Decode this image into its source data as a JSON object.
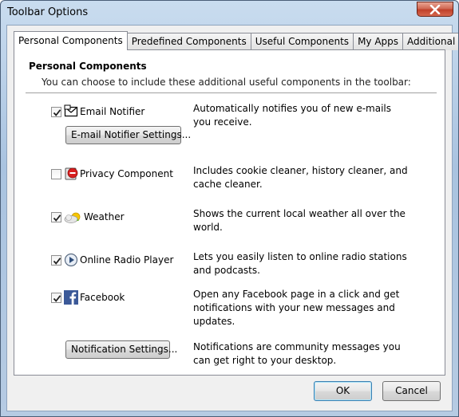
{
  "window": {
    "title": "Toolbar Options"
  },
  "tabs": [
    {
      "label": "Personal Components",
      "active": true
    },
    {
      "label": "Predefined Components"
    },
    {
      "label": "Useful Components"
    },
    {
      "label": "My Apps"
    },
    {
      "label": "Additional Settings"
    }
  ],
  "panel": {
    "title": "Personal Components",
    "description": "You can choose to include these additional useful components in the toolbar:"
  },
  "components": [
    {
      "label": "Email Notifier",
      "checked": true,
      "icon": "envelope-icon",
      "description": "Automatically notifies you of new e-mails you receive."
    },
    {
      "label": "Privacy Component",
      "checked": false,
      "icon": "privacy-icon",
      "description": "Includes cookie cleaner, history cleaner, and cache cleaner."
    },
    {
      "label": "Weather",
      "checked": true,
      "icon": "weather-icon",
      "description": "Shows the current local weather all over the world."
    },
    {
      "label": "Online Radio Player",
      "checked": true,
      "icon": "radio-play-icon",
      "description": "Lets you easily listen to online radio stations and podcasts."
    },
    {
      "label": "Facebook",
      "checked": true,
      "icon": "facebook-icon",
      "description": "Open any Facebook page in a click and get notifications with your new messages and updates."
    }
  ],
  "buttons": {
    "email_settings": "E-mail Notifier Settings...",
    "notification_settings": "Notification Settings...",
    "ok": "OK",
    "cancel": "Cancel"
  },
  "notification_description": "Notifications are community messages you can get right to your desktop."
}
